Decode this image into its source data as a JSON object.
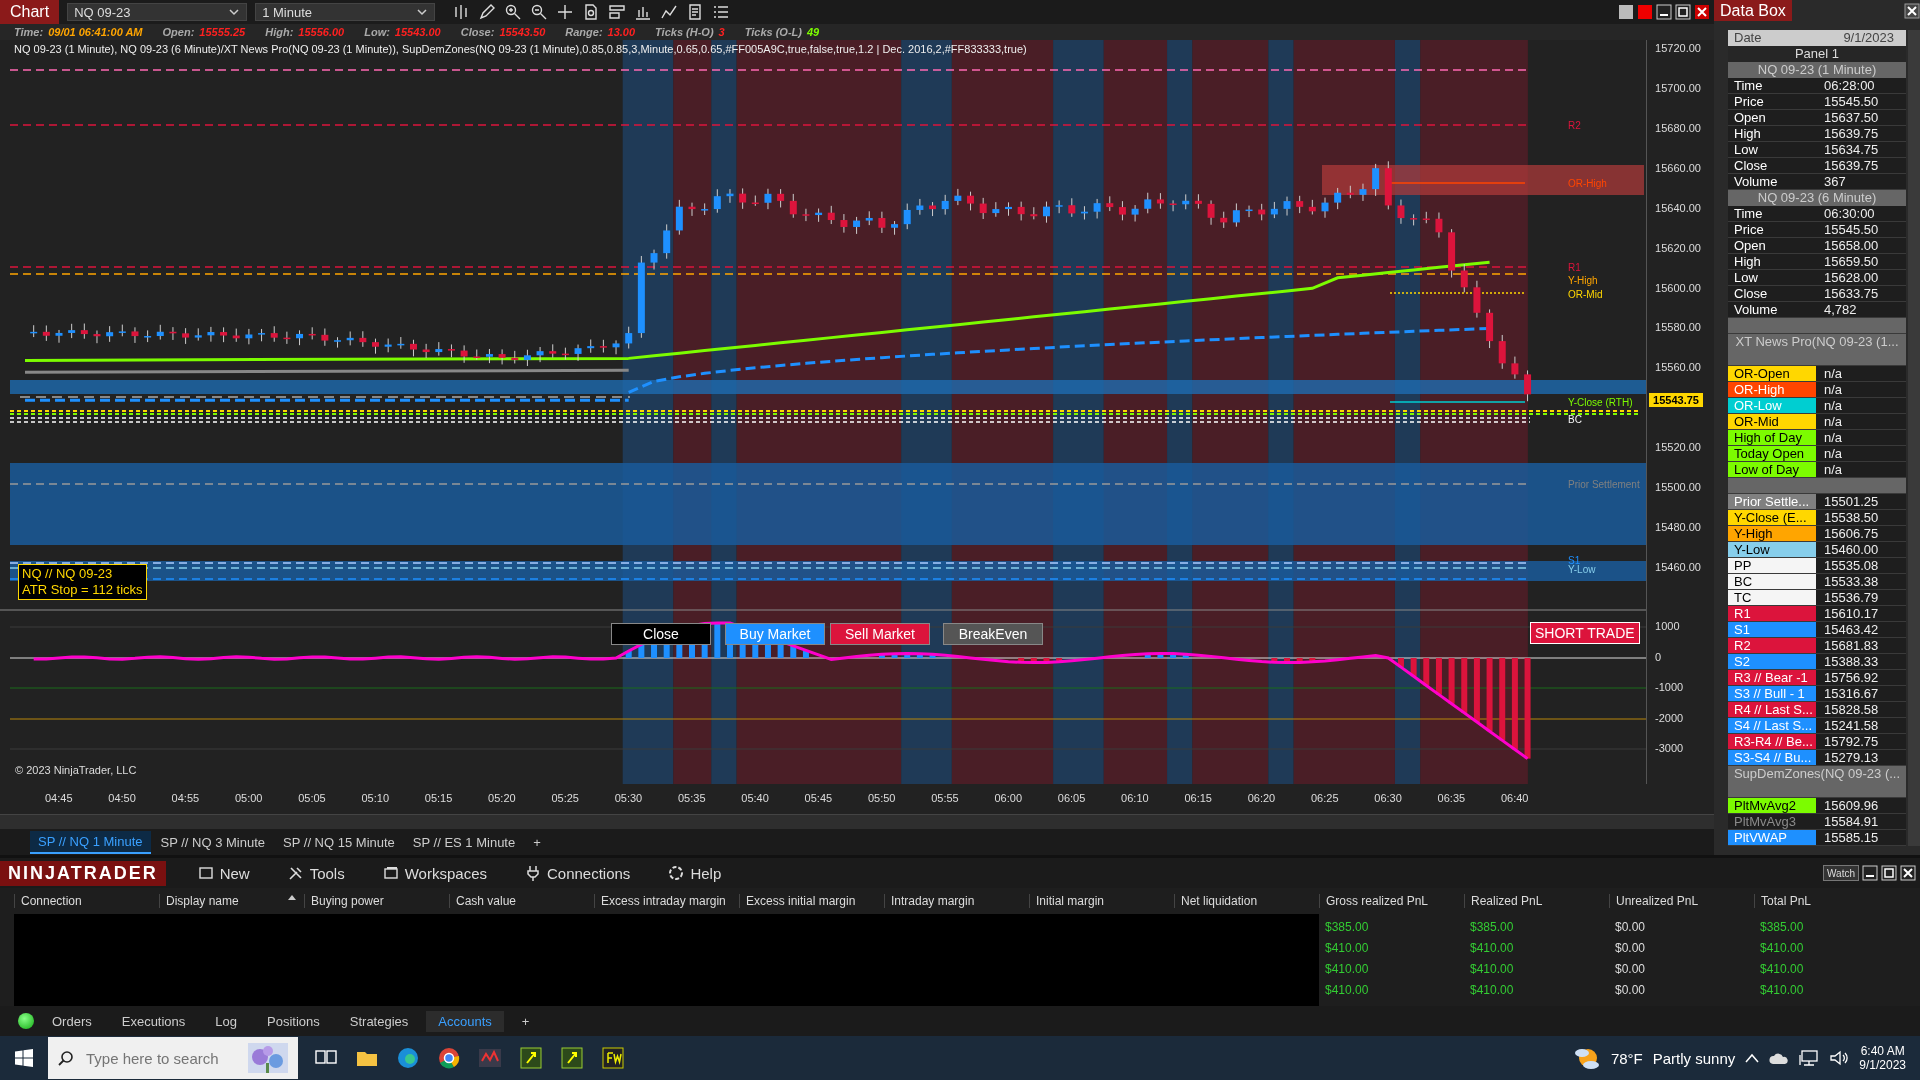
{
  "chart_window": {
    "title": "Chart",
    "instrument": "NQ 09-23",
    "interval": "1 Minute"
  },
  "bar_info": [
    {
      "label": "Time:",
      "value": "09/01 06:41:00 AM",
      "color": "#ffa500"
    },
    {
      "label": "Open:",
      "value": "15555.25",
      "color": "#ff2020"
    },
    {
      "label": "High:",
      "value": "15556.00",
      "color": "#ff2020"
    },
    {
      "label": "Low:",
      "value": "15543.00",
      "color": "#ff2020"
    },
    {
      "label": "Close:",
      "value": "15543.50",
      "color": "#ff2020"
    },
    {
      "label": "Range:",
      "value": "13.00",
      "color": "#ff2020"
    },
    {
      "label": "Ticks (H-O)",
      "value": "3",
      "color": "#ff2020"
    },
    {
      "label": "Ticks (O-L)",
      "value": "49",
      "color": "#7cfc00"
    }
  ],
  "indicator_line": "NQ 09-23 (1 Minute), NQ 09-23 (6 Minute)/XT News Pro(NQ 09-23 (1 Minute)), SupDemZones(NQ 09-23 (1 Minute),0.85,0.85,3,Minute,0.65,0.65,#FF005A9C,true,false,true,1.2 | Dec. 2016,2,#FF833333,true)",
  "price_axis": [
    "15720.00",
    "15700.00",
    "15680.00",
    "15660.00",
    "15640.00",
    "15620.00",
    "15600.00",
    "15580.00",
    "15560.00",
    "15520.00",
    "15500.00",
    "15480.00",
    "15460.00"
  ],
  "last_price": "15543.75",
  "plot_labels": [
    {
      "text": "R2",
      "color": "#dc143c"
    },
    {
      "text": "OR-High",
      "color": "#ff4500"
    },
    {
      "text": "R1",
      "color": "#dc143c"
    },
    {
      "text": "Y-High",
      "color": "#ffa500"
    },
    {
      "text": "OR-Mid",
      "color": "#ffd700"
    },
    {
      "text": "Y-Close (RTH)",
      "color": "#7cfc00"
    },
    {
      "text": "BC",
      "color": "#f5f5f5"
    },
    {
      "text": "Prior Settlement",
      "color": "#808080"
    },
    {
      "text": "S1",
      "color": "#1e90ff"
    },
    {
      "text": "Y-Low",
      "color": "#87ceeb"
    }
  ],
  "atr_box": {
    "lines": [
      "NQ // NQ 09-23",
      "ATR Stop = 112 ticks"
    ]
  },
  "order_buttons": [
    {
      "label": "Close",
      "kind": "close"
    },
    {
      "label": "Buy Market",
      "kind": "buy"
    },
    {
      "label": "Sell Market",
      "kind": "sell"
    },
    {
      "label": "BreakEven",
      "kind": "breakeven"
    }
  ],
  "trade_status": "SHORT TRADE",
  "oscillator_axis": [
    "1000",
    "0",
    "-1000",
    "-2000",
    "-3000"
  ],
  "copyright": "© 2023 NinjaTrader, LLC",
  "time_axis": [
    "04:45",
    "04:50",
    "04:55",
    "05:00",
    "05:05",
    "05:10",
    "05:15",
    "05:20",
    "05:25",
    "05:30",
    "05:35",
    "05:40",
    "05:45",
    "05:50",
    "05:55",
    "06:00",
    "06:05",
    "06:10",
    "06:15",
    "06:20",
    "06:25",
    "06:30",
    "06:35",
    "06:40"
  ],
  "chart_tabs": [
    {
      "label": "SP // NQ 1 Minute",
      "selected": true
    },
    {
      "label": "SP // NQ 3 Minute",
      "selected": false
    },
    {
      "label": "SP // NQ 15 Minute",
      "selected": false
    },
    {
      "label": "SP // ES 1 Minute",
      "selected": false
    },
    {
      "label": "+",
      "selected": false
    }
  ],
  "data_box": {
    "title": "Data Box",
    "rows": [
      {
        "kind": "date",
        "label": "Date",
        "value": "9/1/2023"
      },
      {
        "kind": "panel",
        "label": "Panel 1"
      },
      {
        "kind": "series",
        "label": "NQ 09-23 (1 Minute)"
      },
      {
        "kind": "pair",
        "label": "Time",
        "value": "06:28:00"
      },
      {
        "kind": "pair",
        "label": "Price",
        "value": "15545.50"
      },
      {
        "kind": "pair",
        "label": "Open",
        "value": "15637.50"
      },
      {
        "kind": "pair",
        "label": "High",
        "value": "15639.75"
      },
      {
        "kind": "pair",
        "label": "Low",
        "value": "15634.75"
      },
      {
        "kind": "pair",
        "label": "Close",
        "value": "15639.75"
      },
      {
        "kind": "pair",
        "label": "Volume",
        "value": "367"
      },
      {
        "kind": "series",
        "label": "NQ 09-23 (6 Minute)"
      },
      {
        "kind": "pair",
        "label": "Time",
        "value": "06:30:00"
      },
      {
        "kind": "pair",
        "label": "Price",
        "value": "15545.50"
      },
      {
        "kind": "pair",
        "label": "Open",
        "value": "15658.00"
      },
      {
        "kind": "pair",
        "label": "High",
        "value": "15659.50"
      },
      {
        "kind": "pair",
        "label": "Low",
        "value": "15628.00"
      },
      {
        "kind": "pair",
        "label": "Close",
        "value": "15633.75"
      },
      {
        "kind": "pair",
        "label": "Volume",
        "value": "4,782"
      },
      {
        "kind": "blank"
      },
      {
        "kind": "series",
        "label": "XT News Pro(NQ 09-23 (1..."
      },
      {
        "kind": "blank"
      },
      {
        "kind": "pair",
        "label": "OR-Open",
        "value": "n/a",
        "color": "#ffd700"
      },
      {
        "kind": "pair",
        "label": "OR-High",
        "value": "n/a",
        "color": "#ff4500"
      },
      {
        "kind": "pair",
        "label": "OR-Low",
        "value": "n/a",
        "color": "#00ced1"
      },
      {
        "kind": "pair",
        "label": "OR-Mid",
        "value": "n/a",
        "color": "#ffd700"
      },
      {
        "kind": "pair",
        "label": "High of Day",
        "value": "n/a",
        "color": "#7cfc00"
      },
      {
        "kind": "pair",
        "label": "Today Open",
        "value": "n/a",
        "color": "#7cfc00"
      },
      {
        "kind": "pair",
        "label": "Low of Day",
        "value": "n/a",
        "color": "#7cfc00"
      },
      {
        "kind": "blank"
      },
      {
        "kind": "pair",
        "label": "Prior Settle...",
        "value": "15501.25",
        "color": "#808080"
      },
      {
        "kind": "pair",
        "label": "Y-Close (E...",
        "value": "15538.50",
        "color": "#ffd700"
      },
      {
        "kind": "pair",
        "label": "Y-High",
        "value": "15606.75",
        "color": "#ffa500"
      },
      {
        "kind": "pair",
        "label": "Y-Low",
        "value": "15460.00",
        "color": "#87ceeb"
      },
      {
        "kind": "pair",
        "label": "PP",
        "value": "15535.08",
        "color": "#f5f5f5"
      },
      {
        "kind": "pair",
        "label": "BC",
        "value": "15533.38",
        "color": "#f5f5f5"
      },
      {
        "kind": "pair",
        "label": "TC",
        "value": "15536.79",
        "color": "#f5f5f5"
      },
      {
        "kind": "pair",
        "label": "R1",
        "value": "15610.17",
        "color": "#dc143c"
      },
      {
        "kind": "pair",
        "label": "S1",
        "value": "15463.42",
        "color": "#1e90ff"
      },
      {
        "kind": "pair",
        "label": "R2",
        "value": "15681.83",
        "color": "#dc143c"
      },
      {
        "kind": "pair",
        "label": "S2",
        "value": "15388.33",
        "color": "#1e90ff"
      },
      {
        "kind": "pair",
        "label": "R3 // Bear -1",
        "value": "15756.92",
        "color": "#dc143c"
      },
      {
        "kind": "pair",
        "label": "S3 // Bull - 1",
        "value": "15316.67",
        "color": "#1e90ff"
      },
      {
        "kind": "pair",
        "label": "R4 // Last S...",
        "value": "15828.58",
        "color": "#dc143c"
      },
      {
        "kind": "pair",
        "label": "S4 // Last S...",
        "value": "15241.58",
        "color": "#1e90ff"
      },
      {
        "kind": "pair",
        "label": "R3-R4 // Be...",
        "value": "15792.75",
        "color": "#dc143c"
      },
      {
        "kind": "pair",
        "label": "S3-S4 // Bu...",
        "value": "15279.13",
        "color": "#1e90ff"
      },
      {
        "kind": "series",
        "label": "SupDemZones(NQ 09-23 (..."
      },
      {
        "kind": "blank"
      },
      {
        "kind": "pair",
        "label": "PltMvAvg2",
        "value": "15609.96",
        "color": "#7cfc00"
      },
      {
        "kind": "pair",
        "label": "PltMvAvg3",
        "value": "15584.91",
        "color": "#1e1e1e"
      },
      {
        "kind": "pair",
        "label": "PltVWAP",
        "value": "15585.15",
        "color": "#1e90ff"
      }
    ]
  },
  "main_menu": {
    "logo": "NINJATRADER",
    "items": [
      "New",
      "Tools",
      "Workspaces",
      "Connections",
      "Help"
    ],
    "watch": "Watch"
  },
  "accounts": {
    "columns": [
      {
        "label": "Connection",
        "sorted": false
      },
      {
        "label": "Display name",
        "sorted": true
      },
      {
        "label": "Buying power",
        "sorted": false
      },
      {
        "label": "Cash value",
        "sorted": false
      },
      {
        "label": "Excess intraday margin",
        "sorted": false
      },
      {
        "label": "Excess initial margin",
        "sorted": false
      },
      {
        "label": "Intraday margin",
        "sorted": false
      },
      {
        "label": "Initial margin",
        "sorted": false
      },
      {
        "label": "Net liquidation",
        "sorted": false
      },
      {
        "label": "Gross realized PnL",
        "sorted": false
      },
      {
        "label": "Realized PnL",
        "sorted": false
      },
      {
        "label": "Unrealized PnL",
        "sorted": false
      },
      {
        "label": "Total PnL",
        "sorted": false
      }
    ],
    "rows": [
      [
        "$385.00",
        "$385.00",
        "$0.00",
        "$385.00"
      ],
      [
        "$410.00",
        "$410.00",
        "$0.00",
        "$410.00"
      ],
      [
        "$410.00",
        "$410.00",
        "$0.00",
        "$410.00"
      ],
      [
        "$410.00",
        "$410.00",
        "$0.00",
        "$410.00"
      ]
    ]
  },
  "bottom_tabs": [
    {
      "label": "Orders",
      "selected": false
    },
    {
      "label": "Executions",
      "selected": false
    },
    {
      "label": "Log",
      "selected": false
    },
    {
      "label": "Positions",
      "selected": false
    },
    {
      "label": "Strategies",
      "selected": false
    },
    {
      "label": "Accounts",
      "selected": true
    },
    {
      "label": "+",
      "selected": false
    }
  ],
  "taskbar": {
    "search_placeholder": "Type here to search",
    "temperature": "78°F",
    "weather": "Partly sunny",
    "time": "6:40 AM",
    "date": "9/1/2023"
  }
}
